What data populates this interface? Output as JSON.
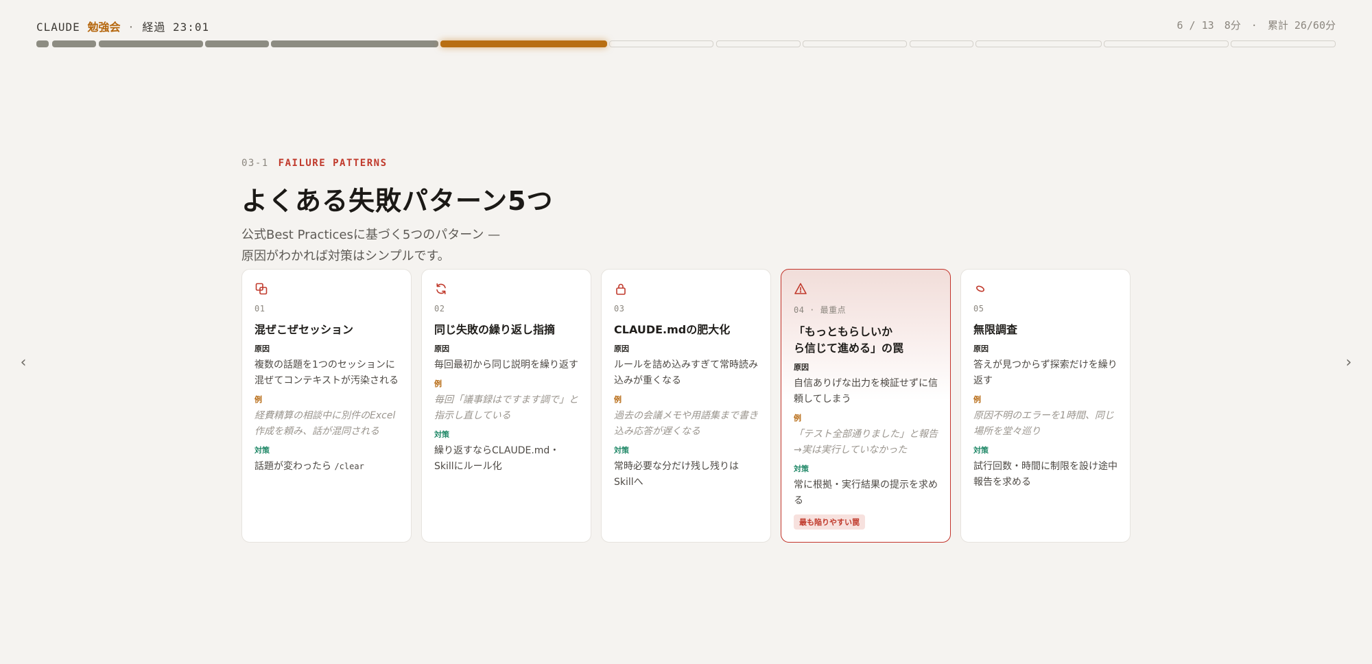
{
  "header": {
    "brand_name": "CLAUDE",
    "brand_accent": "勉強会",
    "separator": "·",
    "elapsed_label": "経過 23:01",
    "slide_position": "6 / 13",
    "slide_time": "8分",
    "meta_separator": "·",
    "total_time": "累計 26/60分"
  },
  "progress": {
    "current_index": 6,
    "total": 13
  },
  "nav": {
    "prev": "‹",
    "next": "›"
  },
  "slide": {
    "section_number": "03-1",
    "section_label": "FAILURE PATTERNS",
    "title": "よくある失敗パターン5つ",
    "subtitle_line1": "公式Best Practicesに基づく5つのパターン —",
    "subtitle_line2": "原因がわかれば対策はシンプルです。"
  },
  "labels": {
    "cause": "原因",
    "example": "例",
    "fix": "対策"
  },
  "cards": [
    {
      "icon": "copy-icon",
      "number": "01",
      "title": "混ぜこぜセッション",
      "cause": "複数の話題を1つのセッションに混ぜてコンテキストが汚染される",
      "example": "経費精算の相談中に別件のExcel作成を頼み、話が混同される",
      "fix": "話題が変わったら",
      "fix_code": "/clear"
    },
    {
      "icon": "refresh-icon",
      "number": "02",
      "title": "同じ失敗の繰り返し指摘",
      "cause": "毎回最初から同じ説明を繰り返す",
      "example": "毎回「議事録はですます調で」と指示し直している",
      "fix": "繰り返すならCLAUDE.md・Skillにルール化"
    },
    {
      "icon": "lock-icon",
      "number": "03",
      "title": "CLAUDE.mdの肥大化",
      "cause": "ルールを詰め込みすぎて常時読み込みが重くなる",
      "example": "過去の会議メモや用語集まで書き込み応答が遅くなる",
      "fix": "常時必要な分だけ残し残りはSkillへ"
    },
    {
      "icon": "warning-icon",
      "number": "04 · 最重点",
      "title_line1": "「もっともらしいか",
      "title_line2": "ら信じて進める」の罠",
      "cause": "自信ありげな出力を検証せずに信頼してしまう",
      "example": "「テスト全部通りました」と報告→実は実行していなかった",
      "fix": "常に根拠・実行結果の提示を求める",
      "badge": "最も陥りやすい罠"
    },
    {
      "icon": "loop-icon",
      "number": "05",
      "title": "無限調査",
      "cause": "答えが見つからず探索だけを繰り返す",
      "example": "原因不明のエラーを1時間、同じ場所を堂々巡り",
      "fix": "試行回数・時間に制限を設け途中報告を求める"
    }
  ],
  "colors": {
    "accent": "#b86e12",
    "danger": "#c0392b",
    "fix": "#1e8766",
    "background": "#f5f3f0"
  }
}
